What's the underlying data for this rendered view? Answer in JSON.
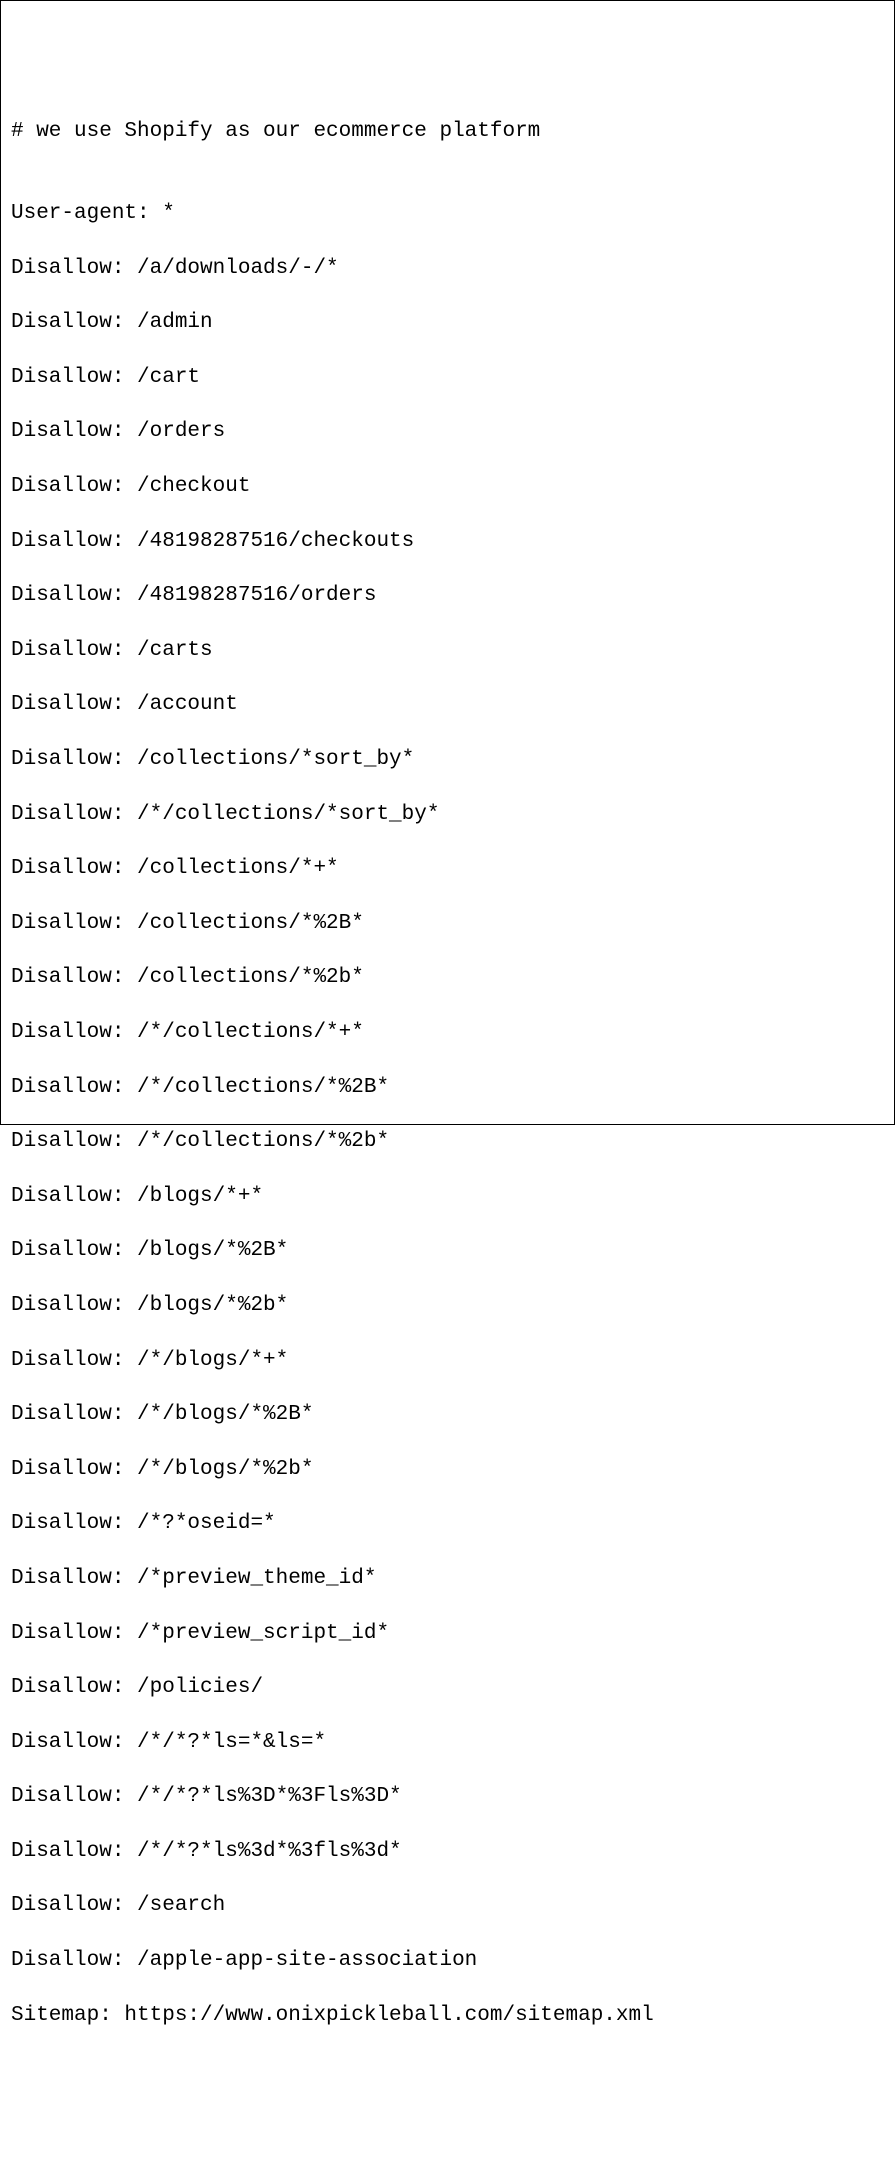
{
  "robots": {
    "comment": "# we use Shopify as our ecommerce platform",
    "blank": "",
    "user_agent_line": "User-agent: *",
    "disallow_lines": [
      "Disallow: /a/downloads/-/*",
      "Disallow: /admin",
      "Disallow: /cart",
      "Disallow: /orders",
      "Disallow: /checkout",
      "Disallow: /48198287516/checkouts",
      "Disallow: /48198287516/orders",
      "Disallow: /carts",
      "Disallow: /account",
      "Disallow: /collections/*sort_by*",
      "Disallow: /*/collections/*sort_by*",
      "Disallow: /collections/*+*",
      "Disallow: /collections/*%2B*",
      "Disallow: /collections/*%2b*",
      "Disallow: /*/collections/*+*",
      "Disallow: /*/collections/*%2B*",
      "Disallow: /*/collections/*%2b*",
      "Disallow: /blogs/*+*",
      "Disallow: /blogs/*%2B*",
      "Disallow: /blogs/*%2b*",
      "Disallow: /*/blogs/*+*",
      "Disallow: /*/blogs/*%2B*",
      "Disallow: /*/blogs/*%2b*",
      "Disallow: /*?*oseid=*",
      "Disallow: /*preview_theme_id*",
      "Disallow: /*preview_script_id*",
      "Disallow: /policies/",
      "Disallow: /*/*?*ls=*&ls=*",
      "Disallow: /*/*?*ls%3D*%3Fls%3D*",
      "Disallow: /*/*?*ls%3d*%3fls%3d*",
      "Disallow: /search",
      "Disallow: /apple-app-site-association"
    ],
    "sitemap_line": "Sitemap: https://www.onixpickleball.com/sitemap.xml"
  }
}
